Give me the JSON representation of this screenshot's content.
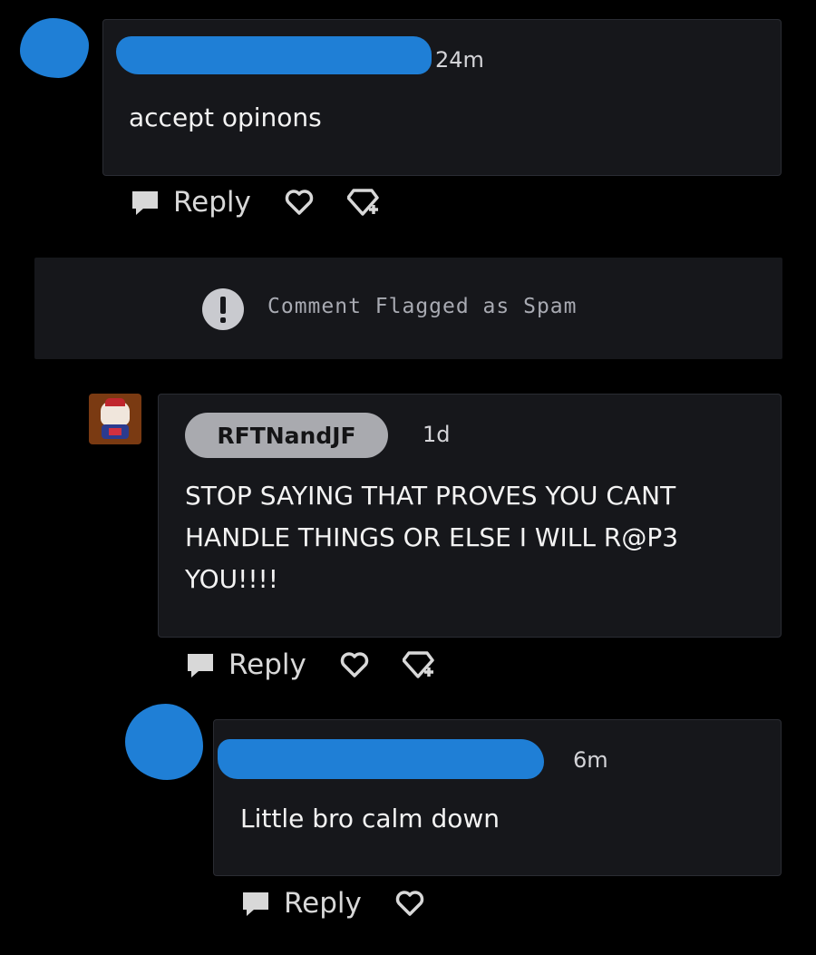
{
  "comments": [
    {
      "time": "24m",
      "text": "accept opinons",
      "reply_label": "Reply"
    },
    {
      "banner_text": "Comment Flagged as Spam"
    },
    {
      "username": "RFTNandJF",
      "time": "1d",
      "text_lines": [
        "STOP SAYING THAT PROVES YOU CANT",
        "HANDLE THINGS OR ELSE I WILL R@P3",
        "YOU!!!!"
      ],
      "reply_label": "Reply"
    },
    {
      "time": "6m",
      "text": "Little bro calm down",
      "reply_label": "Reply"
    }
  ],
  "icons": {
    "reply": "speech-bubble-icon",
    "like": "heart-outline-icon",
    "award": "gem-plus-icon",
    "flag": "exclamation-circle-icon"
  },
  "colors": {
    "background": "#000000",
    "card": "#16171b",
    "redaction": "#1f7fd6",
    "username_pill": "#a9aaaf"
  }
}
